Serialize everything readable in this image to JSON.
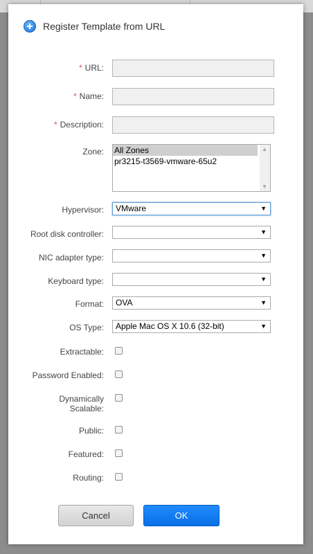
{
  "dialog": {
    "title": "Register Template from URL",
    "icon": "add-circle-icon"
  },
  "fields": {
    "url": {
      "label": "URL:",
      "required": "*",
      "value": ""
    },
    "name": {
      "label": "Name:",
      "required": "*",
      "value": ""
    },
    "description": {
      "label": "Description:",
      "required": "*",
      "value": ""
    },
    "zone": {
      "label": "Zone:",
      "options": [
        "All Zones",
        "pr3215-t3569-vmware-65u2"
      ],
      "selected": "All Zones"
    },
    "hypervisor": {
      "label": "Hypervisor:",
      "value": "VMware"
    },
    "root_disk_controller": {
      "label": "Root disk controller:",
      "value": ""
    },
    "nic_adapter_type": {
      "label": "NIC adapter type:",
      "value": ""
    },
    "keyboard_type": {
      "label": "Keyboard type:",
      "value": ""
    },
    "format": {
      "label": "Format:",
      "value": "OVA"
    },
    "os_type": {
      "label": "OS Type:",
      "value": "Apple Mac OS X 10.6 (32-bit)"
    },
    "extractable": {
      "label": "Extractable:",
      "checked": false
    },
    "password_enabled": {
      "label": "Password Enabled:",
      "checked": false
    },
    "dynamically_scalable": {
      "label_line1": "Dynamically",
      "label_line2": "Scalable:",
      "checked": false
    },
    "public": {
      "label": "Public:",
      "checked": false
    },
    "featured": {
      "label": "Featured:",
      "checked": false
    },
    "routing": {
      "label": "Routing:",
      "checked": false
    }
  },
  "buttons": {
    "cancel": "Cancel",
    "ok": "OK"
  },
  "colors": {
    "accent": "#0a6fe6",
    "required": "#d9534f"
  }
}
